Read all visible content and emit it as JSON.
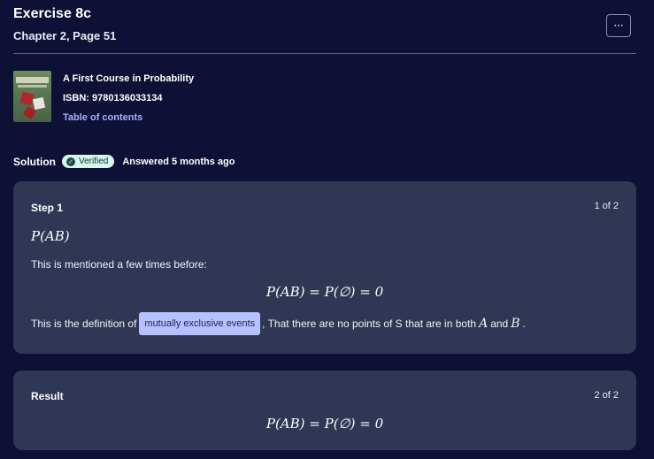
{
  "header": {
    "title": "Exercise 8c",
    "subtitle": "Chapter 2, Page 51",
    "more_label": "···"
  },
  "book": {
    "title": "A First Course in Probability",
    "isbn": "ISBN: 9780136033134",
    "toc_link": "Table of contents"
  },
  "solution": {
    "label": "Solution",
    "verified_label": "Verified",
    "verified_icon": "✓",
    "answered": "Answered 5 months ago"
  },
  "steps": [
    {
      "title": "Step 1",
      "count": "1 of 2",
      "expression": "P(AB)",
      "text1": "This is mentioned a few times before:",
      "equation": "P(AB) = P(∅) = 0",
      "text2_before": "This is the definition of",
      "highlight": "mutually exclusive events",
      "text2_after": ", That there are no points of S that are in both",
      "var_a": "A",
      "and_word": "and",
      "var_b": "B",
      "period": "."
    },
    {
      "title": "Result",
      "count": "2 of 2",
      "equation": "P(AB) = P(∅) = 0"
    }
  ],
  "colors": {
    "background": "#0f1035",
    "card": "#303755",
    "link": "#a8b0ff",
    "highlight": "#b8c0ff",
    "verified_badge": "#d6f6ee"
  }
}
